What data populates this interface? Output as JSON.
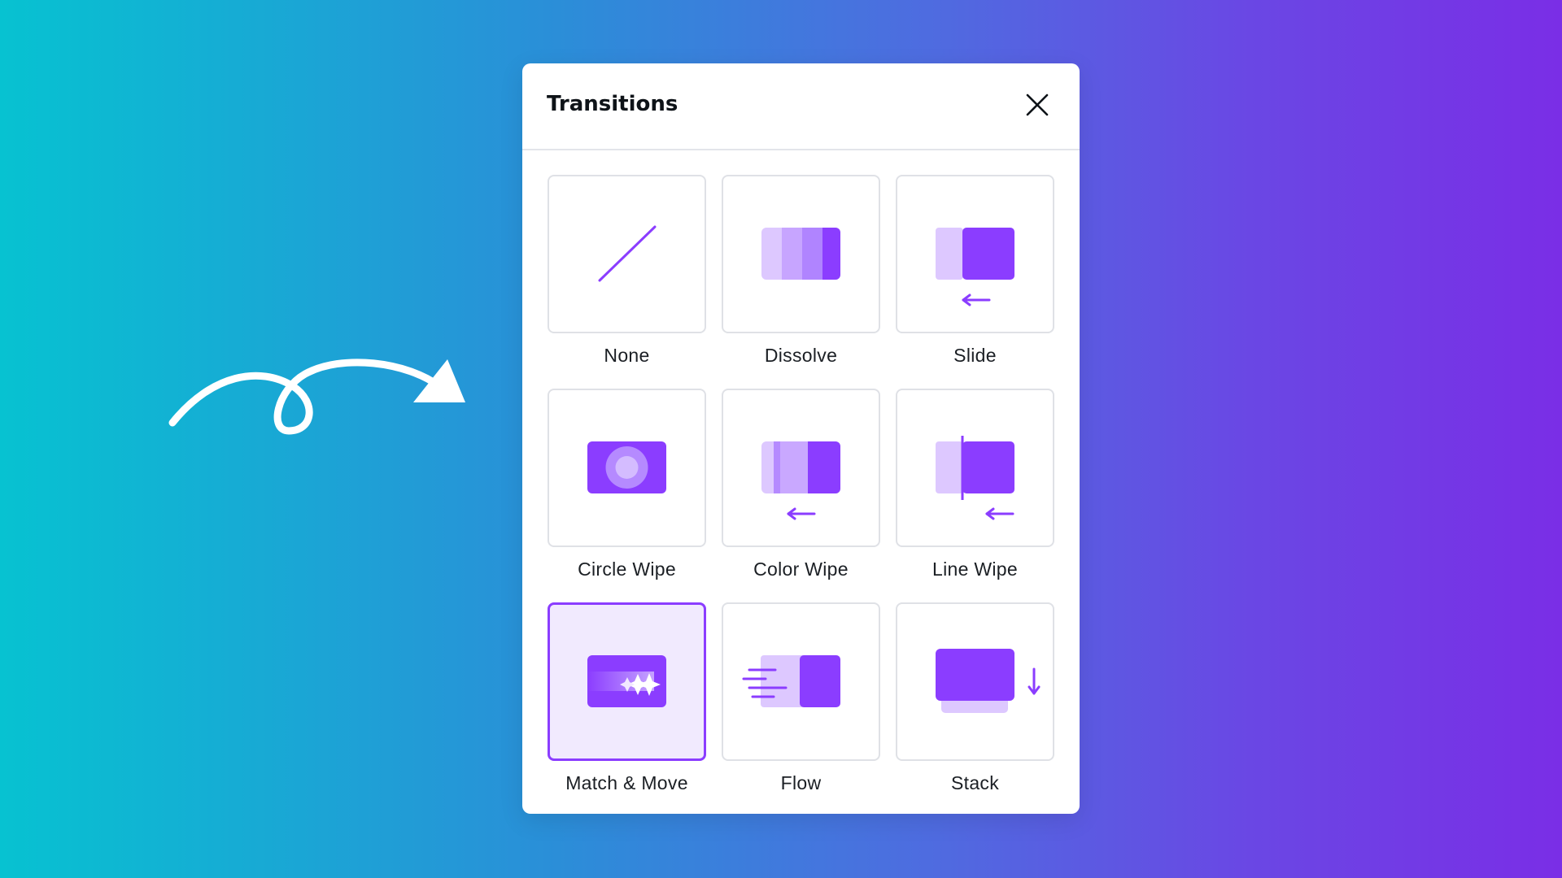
{
  "panel": {
    "title": "Transitions",
    "close_icon": "close-icon"
  },
  "transitions": [
    {
      "label": "None",
      "icon": "none-icon",
      "selected": false
    },
    {
      "label": "Dissolve",
      "icon": "dissolve-icon",
      "selected": false
    },
    {
      "label": "Slide",
      "icon": "slide-icon",
      "selected": false
    },
    {
      "label": "Circle Wipe",
      "icon": "circle-wipe-icon",
      "selected": false
    },
    {
      "label": "Color Wipe",
      "icon": "color-wipe-icon",
      "selected": false
    },
    {
      "label": "Line Wipe",
      "icon": "line-wipe-icon",
      "selected": false
    },
    {
      "label": "Match & Move",
      "icon": "match-move-icon",
      "selected": true
    },
    {
      "label": "Flow",
      "icon": "flow-icon",
      "selected": false
    },
    {
      "label": "Stack",
      "icon": "stack-icon",
      "selected": false
    }
  ],
  "colors": {
    "accent": "#8b3dff",
    "accent_light": "#d9c4ff",
    "accent_mid": "#b58aff",
    "selected_bg": "#f1eafe"
  }
}
